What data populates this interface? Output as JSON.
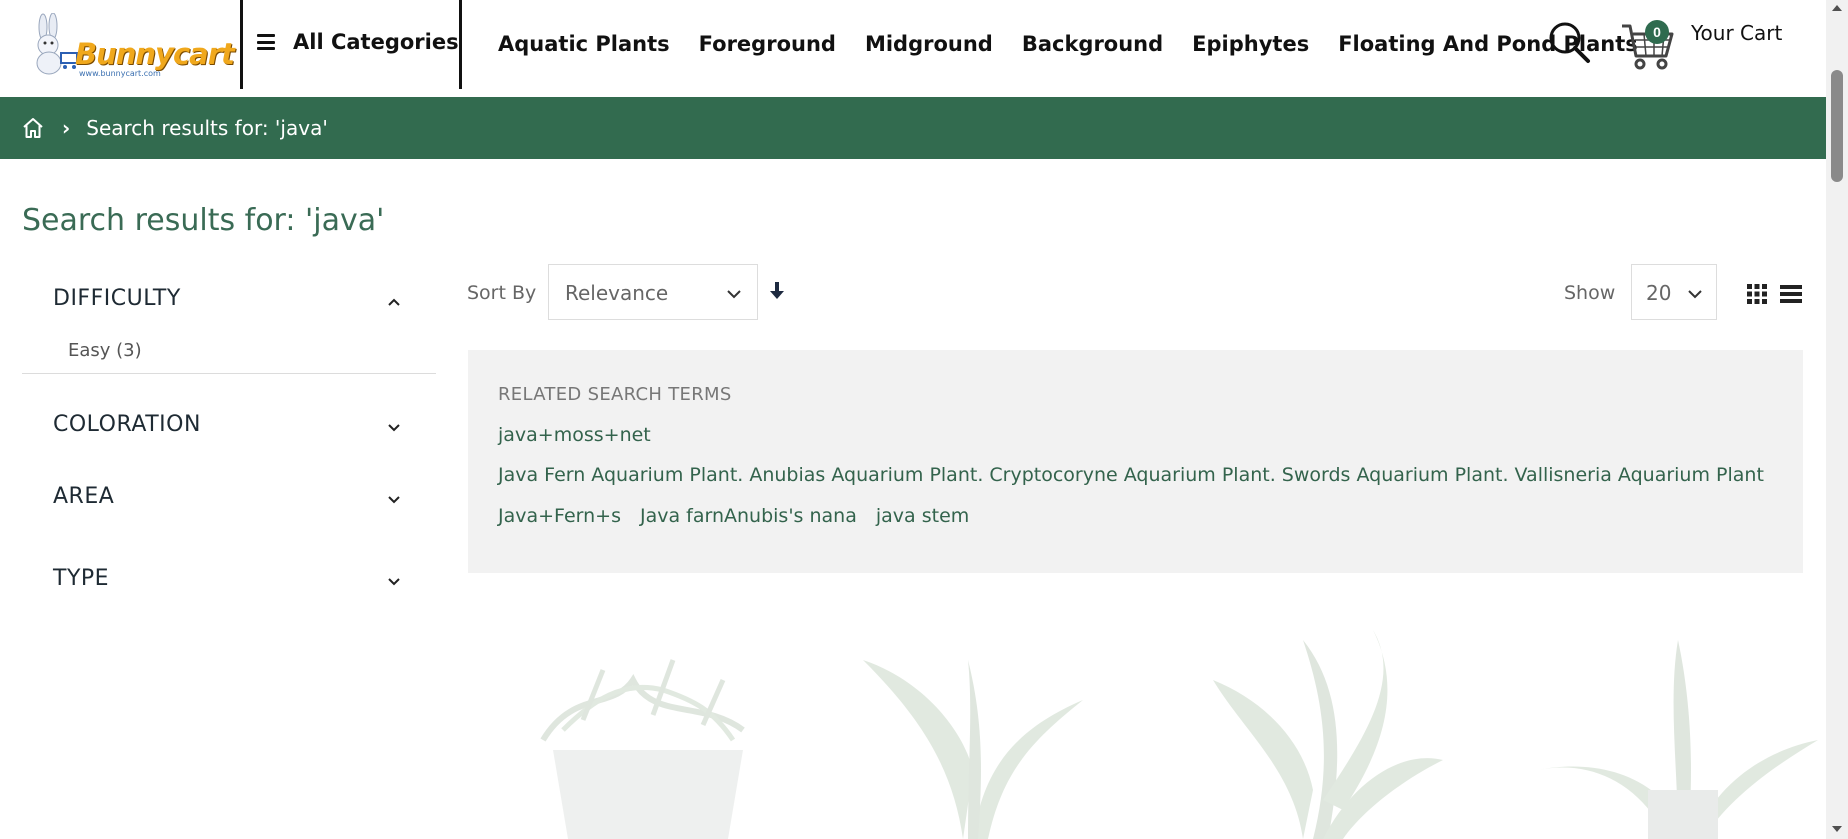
{
  "header": {
    "logo_text": "Bunnycart",
    "logo_url": "www.bunnycart.com",
    "all_categories_label": "All Categories",
    "nav": [
      "Aquatic Plants",
      "Foreground",
      "Midground",
      "Background",
      "Epiphytes",
      "Floating And Pond Plants"
    ],
    "cart": {
      "count": "0",
      "label": "Your Cart"
    }
  },
  "breadcrumb": {
    "current": "Search results for: 'java'"
  },
  "page_title": "Search results for: 'java'",
  "filters": [
    {
      "title": "DIFFICULTY",
      "expanded": true,
      "options": [
        "Easy (3)"
      ]
    },
    {
      "title": "COLORATION",
      "expanded": false
    },
    {
      "title": "AREA",
      "expanded": false
    },
    {
      "title": "TYPE",
      "expanded": false
    }
  ],
  "toolbar": {
    "sort_label": "Sort By",
    "sort_value": "Relevance",
    "show_label": "Show",
    "show_value": "20"
  },
  "related": {
    "title": "RELATED SEARCH TERMS",
    "rows": [
      [
        "java+moss+net"
      ],
      [
        "Java Fern Aquarium Plant. Anubias Aquarium Plant. Cryptocoryne Aquarium Plant. Swords Aquarium Plant. Vallisneria Aquarium Plant"
      ],
      [
        "Java+Fern+s",
        "Java farnAnubis's nana",
        "java stem"
      ]
    ]
  },
  "colors": {
    "brand_green": "#326b4f",
    "link_green": "#33634c",
    "title_green": "#3a6b55"
  },
  "icons": [
    "hamburger-icon",
    "search-icon",
    "cart-icon",
    "home-icon",
    "chevron-right-icon",
    "chevron-up-icon",
    "chevron-down-icon",
    "sort-direction-icon",
    "grid-view-icon",
    "list-view-icon"
  ]
}
